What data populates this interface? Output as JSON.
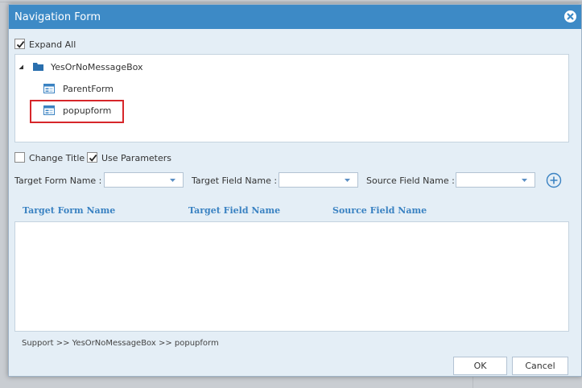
{
  "dialog": {
    "title": "Navigation Form"
  },
  "expand_all": {
    "label": "Expand All",
    "checked": true
  },
  "tree": {
    "root": {
      "label": "YesOrNoMessageBox",
      "expanded": true
    },
    "children": [
      {
        "label": "ParentForm"
      },
      {
        "label": "popupform",
        "highlighted": true
      }
    ]
  },
  "options": {
    "change_title": {
      "label": "Change Title",
      "checked": false
    },
    "use_parameters": {
      "label": "Use Parameters",
      "checked": true
    }
  },
  "mapping": {
    "target_form_label": "Target Form Name :",
    "target_field_label": "Target Field Name :",
    "source_field_label": "Source Field Name :",
    "target_form_value": "",
    "target_field_value": "",
    "source_field_value": ""
  },
  "grid": {
    "columns": [
      "Target Form Name",
      "Target Field Name",
      "Source Field Name"
    ],
    "rows": []
  },
  "breadcrumb": "Support >> YesOrNoMessageBox >> popupform",
  "buttons": {
    "ok": "OK",
    "cancel": "Cancel"
  },
  "colors": {
    "titlebar": "#3d8ac6",
    "dialog_bg": "#e4eef6",
    "column_header": "#3a82c2",
    "highlight": "#d7262a"
  }
}
